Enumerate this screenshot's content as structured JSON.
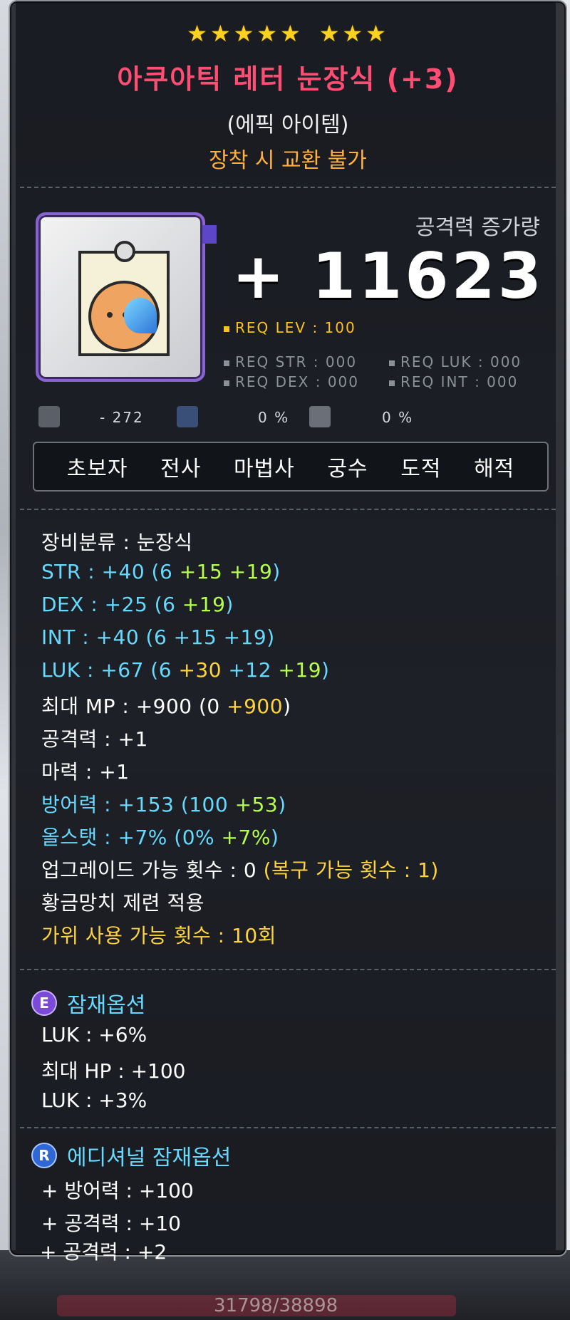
{
  "item": {
    "stars_group1": "★★★★★",
    "stars_group2": "★★★",
    "name": "아쿠아틱 레터 눈장식 (+3)",
    "grade": "(에픽 아이템)",
    "trade_note": "장착 시 교환 불가",
    "icon": "aquatic-letter-eye-accessory-icon"
  },
  "attack_increase": {
    "label": "공격력 증가량",
    "value": "+ 11623"
  },
  "requirements": {
    "lev": "REQ LEV : 100",
    "str": "REQ STR : 000",
    "luk": "REQ LUK : 000",
    "dex": "REQ DEX : 000",
    "int": "REQ INT : 000"
  },
  "extra_stats": {
    "stat1_value": "- 272",
    "stat2_value": "0 %",
    "stat3_value": "0 %"
  },
  "jobs": [
    "초보자",
    "전사",
    "마법사",
    "궁수",
    "도적",
    "해적"
  ],
  "stats": {
    "category": "장비분류 : 눈장식",
    "str_label": "STR : +40 (6 ",
    "str_bonus": "+15 +19",
    "str_close": ")",
    "dex_label": "DEX : +25 (6 ",
    "dex_bonus": "+19",
    "dex_close": ")",
    "int_label": "INT : +40 (6 +15 +19)",
    "luk_label": "LUK : +67 (6 ",
    "luk_bonus1": "+30",
    "luk_bonus2": " +12 ",
    "luk_bonus3": "+19",
    "luk_close": ")",
    "mp_label": "최대 MP : +900 (0 ",
    "mp_bonus": "+900",
    "mp_close": ")",
    "atk": "공격력 : +1",
    "matk": "마력 : +1",
    "def_label": "방어력 : +153 (100 ",
    "def_bonus": "+53",
    "def_close": ")",
    "allstat_label": "올스탯 : +7% (0% ",
    "allstat_bonus": "+7%",
    "allstat_close": ")",
    "upgrade_label": "업그레이드 가능 횟수 : 0 ",
    "upgrade_restore": "(복구 가능 횟수 : 1)",
    "hammer": "황금망치 제련 적용",
    "scissors": "가위 사용 가능 횟수 : 10회"
  },
  "potential": {
    "badge": "E",
    "title": "잠재옵션",
    "lines": [
      "LUK : +6%",
      "최대 HP : +100",
      "LUK : +3%"
    ]
  },
  "additional_potential": {
    "badge": "R",
    "title": "에디셔널 잠재옵션",
    "lines": [
      "+ 방어력 : +100",
      "+ 공격력 : +10",
      "+ 공격력 : +2"
    ]
  },
  "background": {
    "hp_text": "31798/38898"
  },
  "colors": {
    "title": "#ff4d73",
    "cyan_stat": "#66d9ff",
    "green_bonus": "#b6ff4d",
    "yellow_bonus": "#ffd43b",
    "orange_note": "#ffb13c",
    "epic_border": "#8a63d2"
  }
}
